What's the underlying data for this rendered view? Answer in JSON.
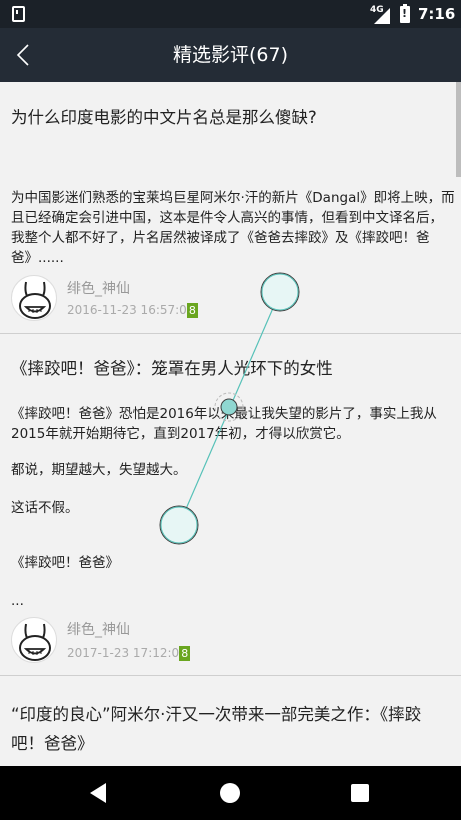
{
  "status_bar": {
    "network_label": "4G",
    "time": "7:16"
  },
  "header": {
    "title": "精选影评(67)",
    "back_icon": "chevron-left-icon"
  },
  "reviews": [
    {
      "title": "为什么印度电影的中文片名总是那么傻缺?",
      "excerpt": "为中国影迷们熟悉的宝莱坞巨星阿米尔·汗的新片《Dangal》即将上映，而且已经确定会引进中国，这本是件令人高兴的事情，但看到中文译名后，我整个人都不好了，片名居然被译成了《爸爸去摔跤》及《摔跤吧！爸爸》......",
      "author": "绯色_神仙",
      "date": "2016-11-23 16:57:0",
      "badge": "8"
    },
    {
      "title": "《摔跤吧！爸爸》：笼罩在男人光环下的女性",
      "paragraphs": [
        "《摔跤吧！爸爸》恐怕是2016年以来最让我失望的影片了，事实上我从2015年就开始期待它，直到2017年初，才得以欣赏它。",
        "都说，期望越大，失望越大。",
        "这话不假。",
        "《摔跤吧！爸爸》",
        "..."
      ],
      "author": "绯色_神仙",
      "date": "2017-1-23 17:12:0",
      "badge": "8"
    },
    {
      "title": "“印度的良心”阿米尔·汗又一次带来一部完美之作：《摔跤吧！爸爸》"
    }
  ],
  "colors": {
    "status_bar": "#1b2128",
    "app_bar": "#242c36",
    "background": "#f2f2f2",
    "badge": "#6aa620",
    "gesture": "#56c1b8"
  },
  "nav_bar": {
    "back_icon": "triangle-back-icon",
    "home_icon": "circle-home-icon",
    "recent_icon": "square-recents-icon"
  }
}
